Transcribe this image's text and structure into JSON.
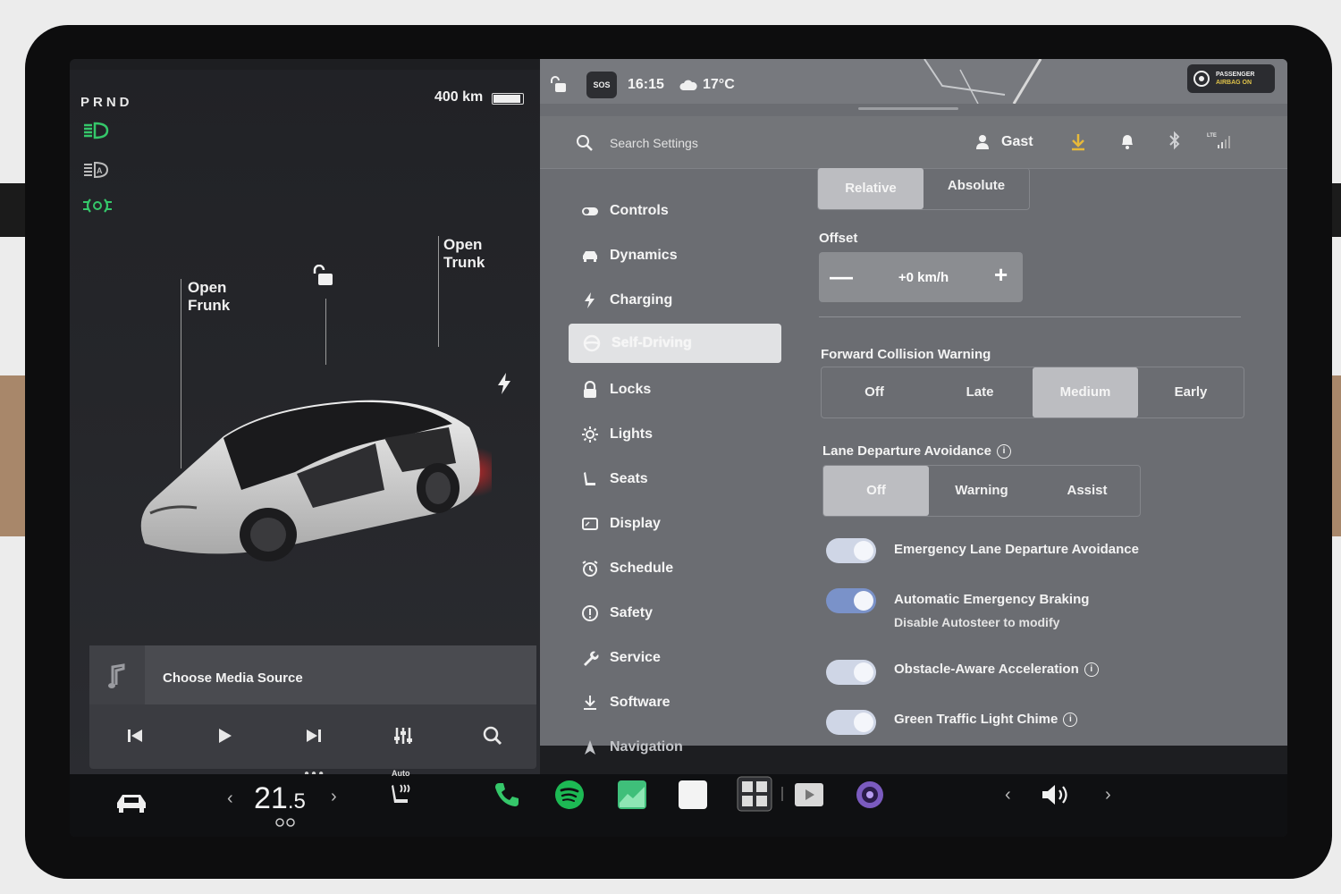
{
  "vehicle": {
    "gear": "PRND",
    "range": "400 km",
    "labels": {
      "frunk": [
        "Open",
        "Frunk"
      ],
      "trunk": [
        "Open",
        "Trunk"
      ]
    }
  },
  "status_bar": {
    "sos": "SOS",
    "time": "16:15",
    "temperature": "17°C",
    "airbag": [
      "PASSENGER",
      "AIRBAG ON"
    ]
  },
  "search": {
    "placeholder": "Search Settings"
  },
  "user": {
    "name": "Gast"
  },
  "nav": [
    {
      "label": "Controls",
      "icon": "toggle-icon"
    },
    {
      "label": "Dynamics",
      "icon": "car-icon"
    },
    {
      "label": "Charging",
      "icon": "lightning-icon"
    },
    {
      "label": "Self-Driving",
      "icon": "steering-wheel-icon",
      "active": true
    },
    {
      "label": "Locks",
      "icon": "lock-icon"
    },
    {
      "label": "Lights",
      "icon": "sun-icon"
    },
    {
      "label": "Seats",
      "icon": "seat-icon"
    },
    {
      "label": "Display",
      "icon": "display-icon"
    },
    {
      "label": "Schedule",
      "icon": "alarm-clock-icon"
    },
    {
      "label": "Safety",
      "icon": "info-circle-icon"
    },
    {
      "label": "Service",
      "icon": "wrench-icon"
    },
    {
      "label": "Software",
      "icon": "download-icon"
    },
    {
      "label": "Navigation",
      "icon": "navigation-arrow-icon"
    }
  ],
  "speed_mode": {
    "options": [
      "Relative",
      "Absolute"
    ],
    "selected": "Relative"
  },
  "offset": {
    "label": "Offset",
    "value": "+0 km/h"
  },
  "fcw": {
    "label": "Forward Collision Warning",
    "options": [
      "Off",
      "Late",
      "Medium",
      "Early"
    ],
    "selected": "Medium"
  },
  "lda": {
    "label": "Lane Departure Avoidance",
    "options": [
      "Off",
      "Warning",
      "Assist"
    ],
    "selected": "Off"
  },
  "toggles": [
    {
      "label": "Emergency Lane Departure Avoidance",
      "on": true
    },
    {
      "label": "Automatic Emergency Braking",
      "sub": "Disable Autosteer to modify",
      "on": true
    },
    {
      "label": "Obstacle-Aware Acceleration",
      "on": true,
      "info": true
    },
    {
      "label": "Green Traffic Light Chime",
      "on": true,
      "info": true
    }
  ],
  "media": {
    "title": "Choose Media Source"
  },
  "climate": {
    "temp_int": "21",
    "temp_dec": ".5",
    "seat_heat": "Auto"
  },
  "colors": {
    "accent_green": "#35c76a",
    "toggle_blue": "#7a92c9",
    "spotify": "#1db954"
  }
}
